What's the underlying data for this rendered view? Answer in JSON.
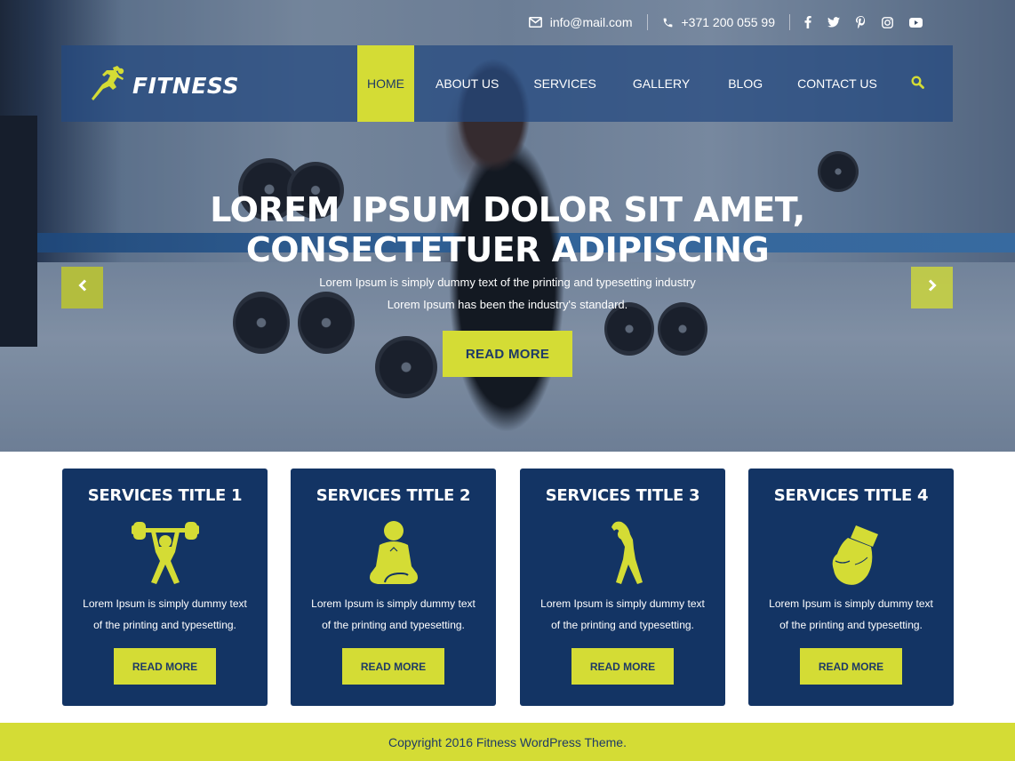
{
  "topbar": {
    "email": "info@mail.com",
    "phone": "+371 200 055 99",
    "social": [
      "facebook",
      "twitter",
      "pinterest",
      "instagram",
      "youtube"
    ]
  },
  "brand": {
    "name": "FITNESS",
    "accent_color": "#d4dc35",
    "primary_color": "#133464"
  },
  "nav": {
    "items": [
      {
        "label": "HOME",
        "active": true
      },
      {
        "label": "ABOUT US",
        "active": false
      },
      {
        "label": "SERVICES",
        "active": false
      },
      {
        "label": "GALLERY",
        "active": false
      },
      {
        "label": "BLOG",
        "active": false
      },
      {
        "label": "CONTACT US",
        "active": false
      }
    ],
    "search_icon": "search-icon"
  },
  "slider": {
    "title_line1": "LOREM IPSUM DOLOR SIT AMET,",
    "title_line2": "CONSECTETUER ADIPISCING",
    "subtitle_line1": "Lorem Ipsum is simply dummy text of the printing and typesetting industry",
    "subtitle_line2": "Lorem Ipsum has been the industry's standard.",
    "button_label": "READ MORE",
    "prev_icon": "chevron-left-icon",
    "next_icon": "chevron-right-icon"
  },
  "services": [
    {
      "title": "SERVICES TITLE 1",
      "icon": "weightlifter-icon",
      "desc_line1": "Lorem Ipsum is simply dummy text",
      "desc_line2": "of the printing and typesetting.",
      "button_label": "READ MORE"
    },
    {
      "title": "SERVICES TITLE 2",
      "icon": "meditation-icon",
      "desc_line1": "Lorem Ipsum is simply dummy text",
      "desc_line2": "of the printing and typesetting.",
      "button_label": "READ MORE"
    },
    {
      "title": "SERVICES TITLE 3",
      "icon": "stretching-icon",
      "desc_line1": "Lorem Ipsum is simply dummy text",
      "desc_line2": "of the printing and typesetting.",
      "button_label": "READ MORE"
    },
    {
      "title": "SERVICES TITLE 4",
      "icon": "boxing-glove-icon",
      "desc_line1": "Lorem Ipsum is simply dummy text",
      "desc_line2": "of the printing and typesetting.",
      "button_label": "READ MORE"
    }
  ],
  "footer": {
    "copyright": "Copyright 2016 Fitness WordPress Theme."
  }
}
